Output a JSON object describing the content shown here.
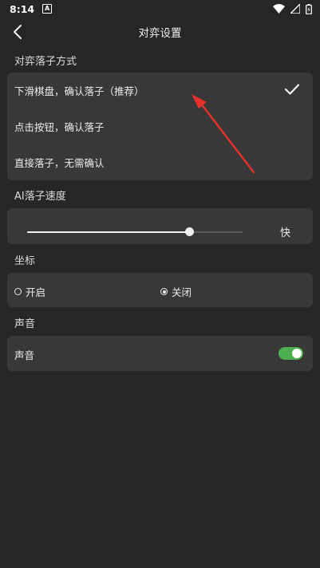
{
  "status_bar": {
    "time": "8:14",
    "a_icon": "A"
  },
  "header": {
    "title": "对弈设置"
  },
  "move_method": {
    "label": "对弈落子方式",
    "options": [
      {
        "label": "下滑棋盘，确认落子（推荐）",
        "selected": true
      },
      {
        "label": "点击按钮，确认落子",
        "selected": false
      },
      {
        "label": "直接落子，无需确认",
        "selected": false
      }
    ]
  },
  "ai_speed": {
    "label": "AI落子速度",
    "value_label": "快",
    "level": 0.75
  },
  "coordinates": {
    "label": "坐标",
    "options": [
      {
        "label": "开启",
        "selected": false
      },
      {
        "label": "关闭",
        "selected": true
      }
    ]
  },
  "sound": {
    "section_label": "声音",
    "row_label": "声音",
    "enabled": true
  },
  "colors": {
    "background": "#262626",
    "card": "#383838",
    "toggle_on": "#4caf50",
    "annotation": "#e8302a"
  }
}
